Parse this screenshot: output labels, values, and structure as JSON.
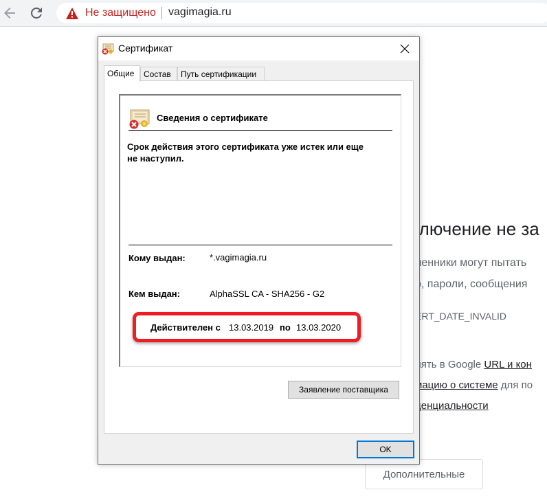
{
  "browser": {
    "not_secure": "Не защищено",
    "url": "vagimagia.ru",
    "colors": {
      "warning": "#c5221f"
    },
    "icons": [
      "back-arrow-icon",
      "reload-icon",
      "warning-triangle-icon"
    ]
  },
  "error_page": {
    "title": "ключение не за",
    "para1": "ленники могут пытать",
    "para2": "р, пароли, сообщения",
    "error_code": "ERT_DATE_INVALID",
    "line1_text": "лять в Google ",
    "line1_link": "URL и кон",
    "line2_link": "мацию о системе",
    "line2_text": " для по",
    "line3_link": "денциальности",
    "advanced_button": "Дополнительные"
  },
  "dialog": {
    "title": "Сертификат",
    "tabs": [
      {
        "label": "Общие",
        "active": true
      },
      {
        "label": "Состав",
        "active": false
      },
      {
        "label": "Путь сертификации",
        "active": false
      }
    ],
    "info_heading": "Сведения о сертификате",
    "status_text": "Срок действия этого сертификата уже истек или еще не наступил.",
    "issued_to_label": "Кому выдан:",
    "issued_to_value": "*.vagimagia.ru",
    "issued_by_label": "Кем выдан:",
    "issued_by_value": "AlphaSSL CA - SHA256 - G2",
    "valid_from_label": "Действителен с",
    "valid_from_value": "13.03.2019",
    "valid_to_label": "по",
    "valid_to_value": "13.03.2020",
    "issuer_statement_button": "Заявление поставщика",
    "ok_button": "OK",
    "colors": {
      "highlight": "#ee1d23",
      "ok_border": "#0078d7"
    },
    "icons": [
      "certificate-error-icon",
      "close-icon"
    ]
  }
}
